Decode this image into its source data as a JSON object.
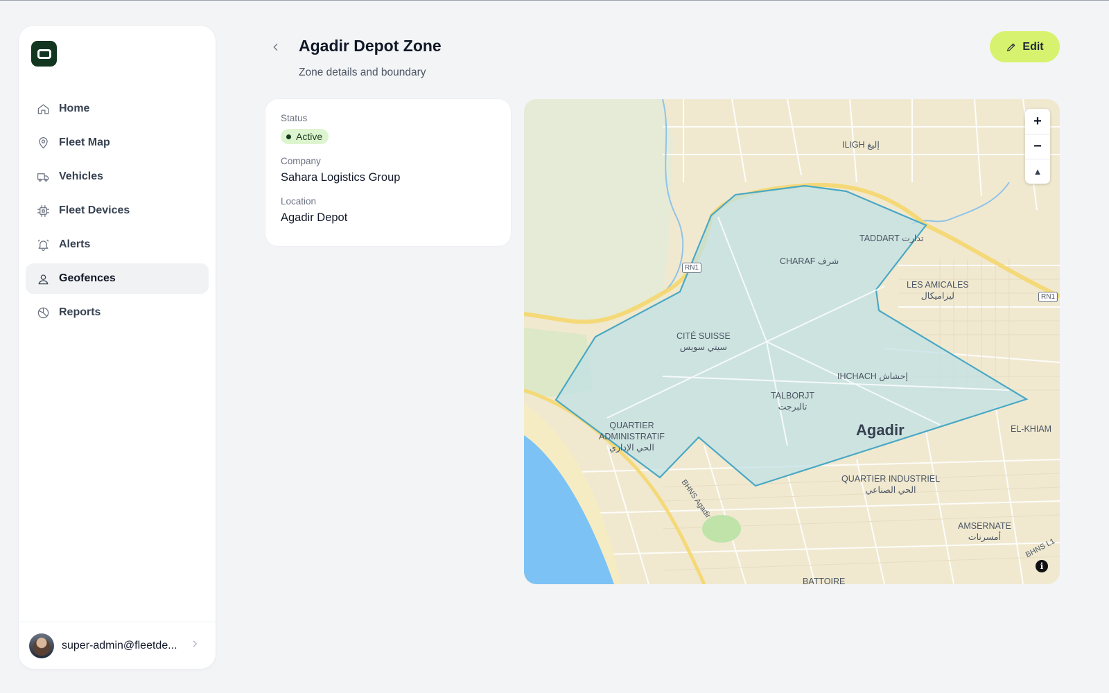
{
  "sidebar": {
    "items": [
      {
        "label": "Home",
        "icon": "home-icon"
      },
      {
        "label": "Fleet Map",
        "icon": "map-pin-icon"
      },
      {
        "label": "Vehicles",
        "icon": "truck-icon"
      },
      {
        "label": "Fleet Devices",
        "icon": "chip-icon"
      },
      {
        "label": "Alerts",
        "icon": "bell-icon"
      },
      {
        "label": "Geofences",
        "icon": "geofence-icon",
        "active": true
      },
      {
        "label": "Reports",
        "icon": "pie-chart-icon"
      }
    ],
    "user": {
      "email": "super-admin@fleetde..."
    }
  },
  "header": {
    "title": "Agadir Depot Zone",
    "subtitle": "Zone details and boundary",
    "edit_label": "Edit"
  },
  "details": {
    "status_label": "Status",
    "status_value": "Active",
    "company_label": "Company",
    "company_value": "Sahara Logistics Group",
    "location_label": "Location",
    "location_value": "Agadir Depot"
  },
  "map": {
    "labels": {
      "iligh": "ILIGH إليغ",
      "taddart": "TADDART تدارت",
      "charaf": "CHARAF شرف",
      "amicales_1": "LES AMICALES",
      "amicales_2": "ليزاميكال",
      "cite_1": "CITÉ SUISSE",
      "cite_2": "سيتي سويس",
      "ihchach": "IHCHACH إحشاش",
      "talborjt_1": "TALBORJT",
      "talborjt_2": "تالبرجت",
      "quartier_adm_1": "QUARTIER",
      "quartier_adm_2": "ADMINISTRATIF",
      "quartier_adm_3": "الحي الإداري",
      "agadir": "Agadir",
      "el_khiam": "EL-KHIAM",
      "industriel_1": "QUARTIER INDUSTRIEL",
      "industriel_2": "الحي الصناعي",
      "amsernate_1": "AMSERNATE",
      "amsernate_2": "أمسرنات",
      "battoire": "BATTOIRE",
      "bhns": "BHNS Agadir",
      "bhns_l1": "BHNS L1",
      "rn1_a": "RN1",
      "rn1_b": "RN1"
    },
    "zoom_in": "+",
    "zoom_out": "−",
    "compass": "▲",
    "info": "i",
    "colors": {
      "zone_fill": "#bfe0e6",
      "zone_stroke": "#4aa8c4",
      "water": "#7cc2f4"
    }
  }
}
